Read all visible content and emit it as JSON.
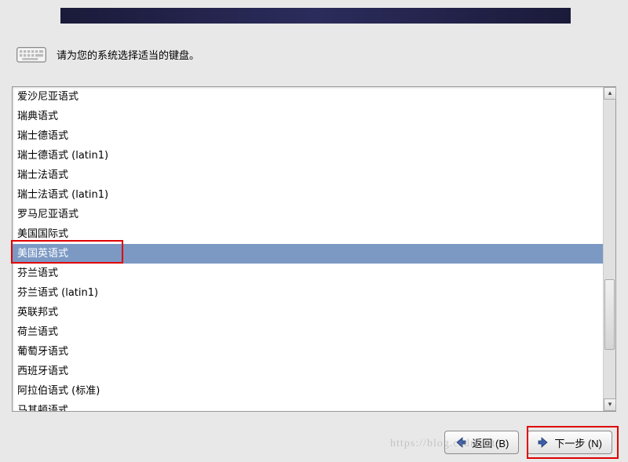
{
  "prompt": "请为您的系统选择适当的键盘。",
  "keyboard_layouts": [
    {
      "label": "爱沙尼亚语式",
      "selected": false
    },
    {
      "label": "瑞典语式",
      "selected": false
    },
    {
      "label": "瑞士德语式",
      "selected": false
    },
    {
      "label": "瑞士德语式 (latin1)",
      "selected": false
    },
    {
      "label": "瑞士法语式",
      "selected": false
    },
    {
      "label": "瑞士法语式 (latin1)",
      "selected": false
    },
    {
      "label": "罗马尼亚语式",
      "selected": false
    },
    {
      "label": "美国国际式",
      "selected": false
    },
    {
      "label": "美国英语式",
      "selected": true
    },
    {
      "label": "芬兰语式",
      "selected": false
    },
    {
      "label": "芬兰语式 (latin1)",
      "selected": false
    },
    {
      "label": "英联邦式",
      "selected": false
    },
    {
      "label": "荷兰语式",
      "selected": false
    },
    {
      "label": "葡萄牙语式",
      "selected": false
    },
    {
      "label": "西班牙语式",
      "selected": false
    },
    {
      "label": "阿拉伯语式 (标准)",
      "selected": false
    },
    {
      "label": "马其顿语式",
      "selected": false
    }
  ],
  "buttons": {
    "back": "返回 (B)",
    "next": "下一步 (N)"
  },
  "watermark": "https://blog.csdn.net/..."
}
